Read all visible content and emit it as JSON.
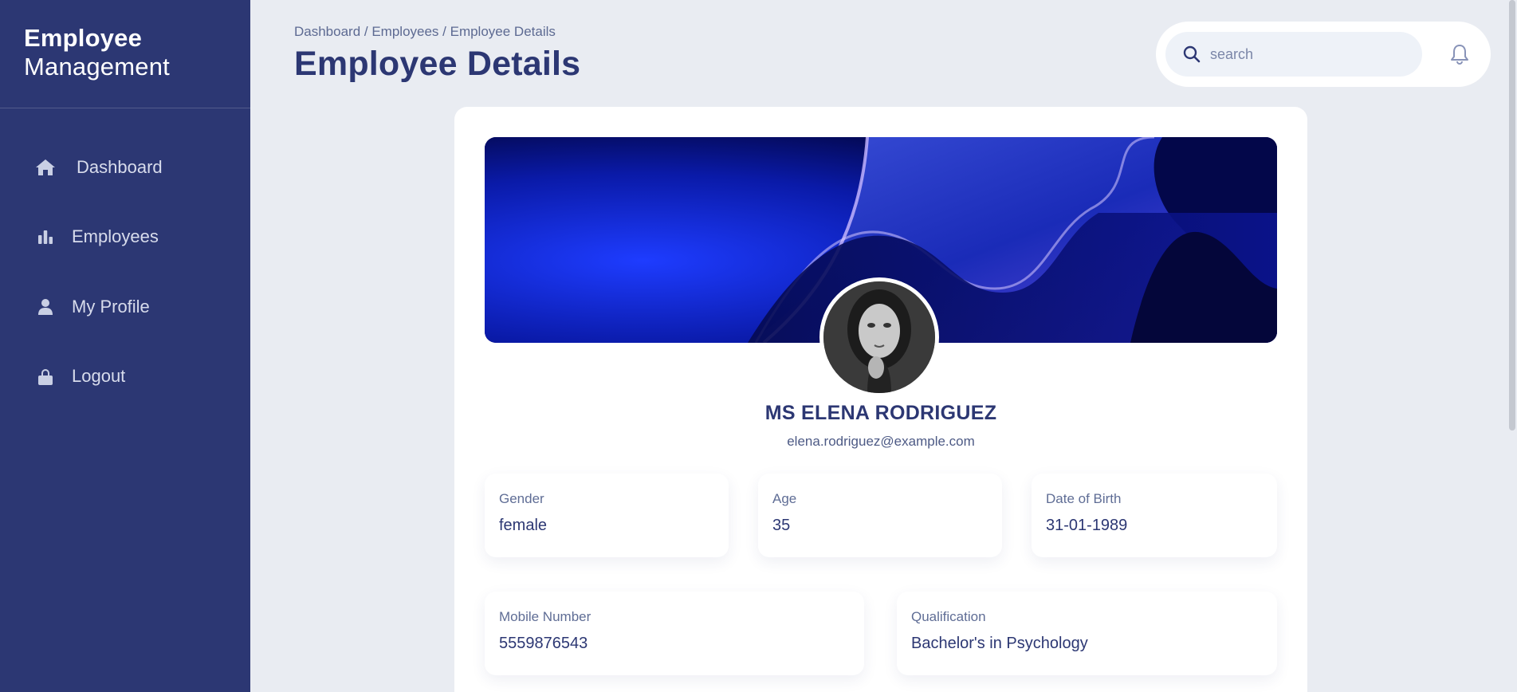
{
  "brand": {
    "line1": "Employee",
    "line2": "Management"
  },
  "sidebar": {
    "items": [
      {
        "label": "Dashboard",
        "icon": "home-icon"
      },
      {
        "label": "Employees",
        "icon": "bar-chart-icon"
      },
      {
        "label": "My Profile",
        "icon": "user-icon"
      },
      {
        "label": "Logout",
        "icon": "lock-icon"
      }
    ]
  },
  "header": {
    "breadcrumb": "Dashboard / Employees / Employee Details",
    "title": "Employee Details",
    "search_placeholder": "search"
  },
  "employee": {
    "name": "MS ELENA RODRIGUEZ",
    "email": "elena.rodriguez@example.com",
    "fields": {
      "gender": {
        "label": "Gender",
        "value": "female"
      },
      "age": {
        "label": "Age",
        "value": "35"
      },
      "dob": {
        "label": "Date of Birth",
        "value": "31-01-1989"
      },
      "mobile": {
        "label": "Mobile Number",
        "value": "5559876543"
      },
      "qualification": {
        "label": "Qualification",
        "value": "Bachelor's in Psychology"
      }
    }
  },
  "colors": {
    "sidebar_bg": "#2c3773",
    "page_bg": "#e9ecf2",
    "accent": "#2c3773"
  }
}
